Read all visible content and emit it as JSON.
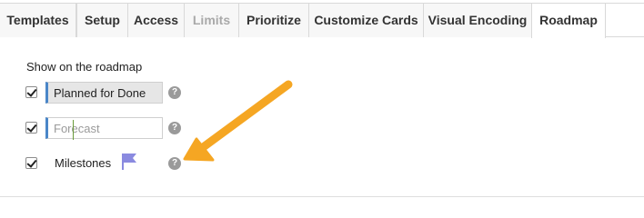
{
  "tabs": [
    {
      "label": "Templates",
      "state": "normal"
    },
    {
      "label": "Setup",
      "state": "normal"
    },
    {
      "label": "Access",
      "state": "normal"
    },
    {
      "label": "Limits",
      "state": "disabled"
    },
    {
      "label": "Prioritize",
      "state": "normal"
    },
    {
      "label": "Customize Cards",
      "state": "normal"
    },
    {
      "label": "Visual Encoding",
      "state": "normal"
    },
    {
      "label": "Roadmap",
      "state": "active"
    }
  ],
  "roadmap": {
    "section_title": "Show on the roadmap",
    "options": [
      {
        "checked": true,
        "label": "Planned for Done",
        "help_icon": "question-circle-icon"
      },
      {
        "checked": true,
        "label": "Forecast",
        "help_icon": "question-circle-icon"
      },
      {
        "checked": true,
        "label": "Milestones",
        "icon": "flag-icon",
        "help_icon": "question-circle-icon"
      }
    ]
  },
  "colors": {
    "field_accent": "#4a86c8",
    "flag": "#8a8ae0",
    "annotation_arrow": "#f5a623",
    "help_icon": "#9a9a9a"
  }
}
